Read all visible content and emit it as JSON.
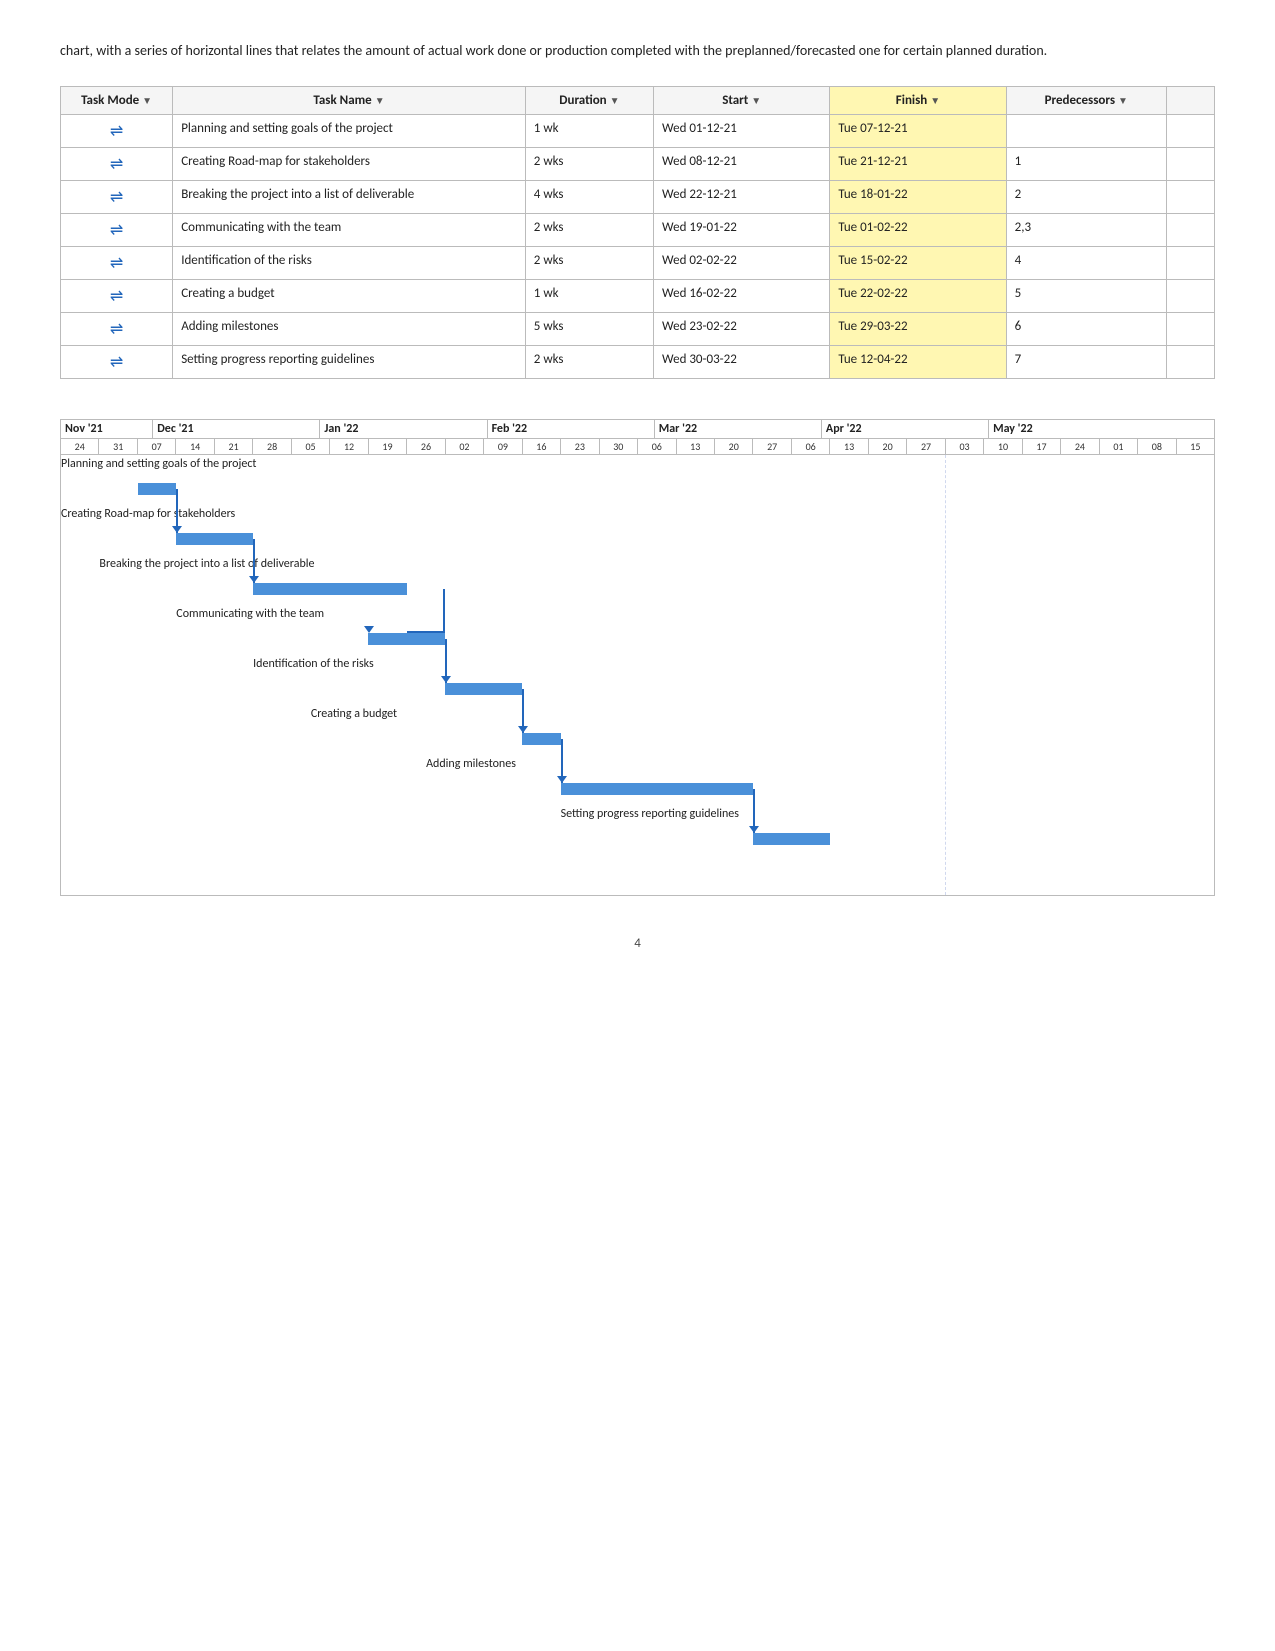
{
  "intro": {
    "text": "chart, with a series of horizontal lines that relates the amount of actual work done or production completed with the preplanned/forecasted one for certain planned duration."
  },
  "table": {
    "headers": {
      "task_mode": "Task Mode",
      "task_name": "Task Name",
      "duration": "Duration",
      "start": "Start",
      "finish": "Finish",
      "predecessors": "Predecessors"
    },
    "rows": [
      {
        "mode": "🖧",
        "name": "Planning and setting goals of the project",
        "duration": "1 wk",
        "start": "Wed 01-12-21",
        "finish": "Tue 07-12-21",
        "predecessors": ""
      },
      {
        "mode": "🖧",
        "name": "Creating Road-map for stakeholders",
        "duration": "2 wks",
        "start": "Wed 08-12-21",
        "finish": "Tue 21-12-21",
        "predecessors": "1"
      },
      {
        "mode": "🖧",
        "name": "Breaking the project into a list of deliverable",
        "duration": "4 wks",
        "start": "Wed 22-12-21",
        "finish": "Tue 18-01-22",
        "predecessors": "2"
      },
      {
        "mode": "🖧",
        "name": "Communicating with the team",
        "duration": "2 wks",
        "start": "Wed 19-01-22",
        "finish": "Tue 01-02-22",
        "predecessors": "2,3"
      },
      {
        "mode": "🖧",
        "name": "Identification of the risks",
        "duration": "2 wks",
        "start": "Wed 02-02-22",
        "finish": "Tue 15-02-22",
        "predecessors": "4"
      },
      {
        "mode": "🖧",
        "name": "Creating a budget",
        "duration": "1 wk",
        "start": "Wed 16-02-22",
        "finish": "Tue 22-02-22",
        "predecessors": "5"
      },
      {
        "mode": "🖧",
        "name": "Adding milestones",
        "duration": "5 wks",
        "start": "Wed 23-02-22",
        "finish": "Tue 29-03-22",
        "predecessors": "6"
      },
      {
        "mode": "🖧",
        "name": "Setting progress reporting guidelines",
        "duration": "2 wks",
        "start": "Wed 30-03-22",
        "finish": "Tue 12-04-22",
        "predecessors": "7"
      }
    ]
  },
  "gantt": {
    "months": [
      "Nov '21",
      "Dec '21",
      "Jan '22",
      "Feb '22",
      "Mar '22",
      "Apr '22",
      "May '22"
    ],
    "weeks": [
      "24",
      "31",
      "07",
      "14",
      "21",
      "28",
      "05",
      "12",
      "19",
      "26",
      "02",
      "09",
      "16",
      "23",
      "30",
      "06",
      "13",
      "20",
      "27",
      "06",
      "13",
      "20",
      "27",
      "03",
      "10",
      "17",
      "24",
      "01",
      "08",
      "15"
    ],
    "tasks": [
      {
        "label": "Planning and setting goals of the project",
        "bar_start_pct": 2,
        "bar_width_pct": 6.5
      },
      {
        "label": "Creating Road-map for stakeholders",
        "bar_start_pct": 9,
        "bar_width_pct": 13
      },
      {
        "label": "Breaking the project into a list of deliverable",
        "bar_start_pct": 22,
        "bar_width_pct": 26
      },
      {
        "label": "Communicating with the team",
        "bar_start_pct": 35,
        "bar_width_pct": 13
      },
      {
        "label": "Identification of the risks",
        "bar_start_pct": 48,
        "bar_width_pct": 13
      },
      {
        "label": "Creating a budget",
        "bar_start_pct": 54,
        "bar_width_pct": 6.5
      },
      {
        "label": "Adding milestones",
        "bar_start_pct": 61,
        "bar_width_pct": 32
      },
      {
        "label": "Setting progress reporting guidelines",
        "bar_start_pct": 74,
        "bar_width_pct": 13
      }
    ]
  },
  "page_number": "4"
}
